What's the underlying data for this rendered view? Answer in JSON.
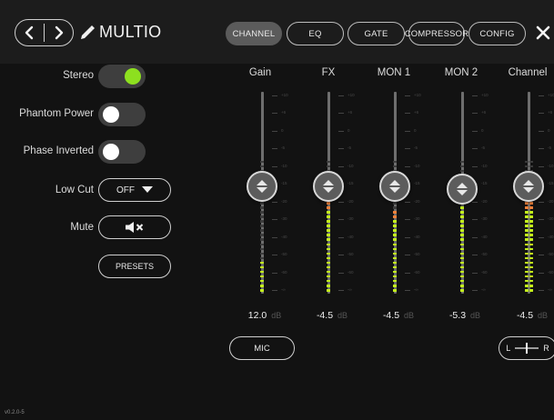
{
  "header": {
    "app_title": "MULTIO",
    "tabs": [
      {
        "label": "CHANNEL",
        "active": true
      },
      {
        "label": "EQ",
        "active": false
      },
      {
        "label": "GATE",
        "active": false
      },
      {
        "label": "COMPRESSOR",
        "active": false
      },
      {
        "label": "CONFIG",
        "active": false
      }
    ],
    "icons": [
      "chevron-left-icon",
      "chevron-right-icon",
      "pencil-icon",
      "close-icon"
    ]
  },
  "controls": {
    "stereo_label": "Stereo",
    "stereo_on": true,
    "phantom_label": "Phantom Power",
    "phantom_on": false,
    "phase_label": "Phase Inverted",
    "phase_on": false,
    "lowcut_label": "Low Cut",
    "lowcut_value": "OFF",
    "mute_label": "Mute",
    "presets_label": "PRESETS"
  },
  "faders": [
    {
      "name": "Gain",
      "value": "12.0",
      "unit": "dB",
      "level": 0.53,
      "meter": 0.17
    },
    {
      "name": "FX",
      "value": "-4.5",
      "unit": "dB",
      "level": 0.53,
      "meter": 0.45
    },
    {
      "name": "MON 1",
      "value": "-4.5",
      "unit": "dB",
      "level": 0.53,
      "meter": 0.42
    },
    {
      "name": "MON 2",
      "value": "-5.3",
      "unit": "dB",
      "level": 0.52,
      "meter": 0.49
    },
    {
      "name": "Channel",
      "value": "-4.5",
      "unit": "dB",
      "level": 0.53,
      "meter": 0.45
    }
  ],
  "scale_labels": [
    "+10",
    "+6",
    "0",
    "-5",
    "-10",
    "-15",
    "-20",
    "-30",
    "-40",
    "-50",
    "-60",
    "-∞"
  ],
  "input_button_label": "MIC",
  "pan": {
    "left_label": "L",
    "right_label": "R",
    "value": 0
  },
  "version": "v0.2.0-5",
  "colors": {
    "accent_green": "#8de01f",
    "meter_green": "#c4f21c",
    "meter_orange": "#f0813a",
    "meter_off": "#3c3c3c"
  }
}
